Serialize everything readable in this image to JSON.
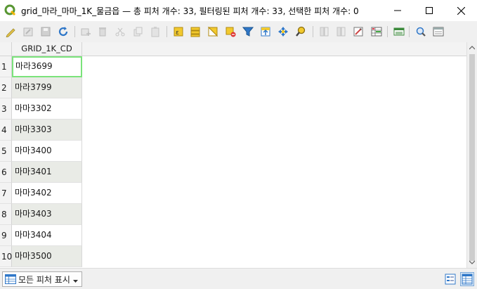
{
  "window": {
    "title": "grid_마라_마마_1K_물금읍 — 총 피처 개수: 33, 필터링된 피처 개수: 33, 선택한 피처 개수: 0"
  },
  "toolbar": {
    "icons": [
      "pencil-icon",
      "multi-edit-icon",
      "save-icon",
      "reload-icon",
      "add-feature-icon",
      "delete-icon",
      "cut-icon",
      "copy-icon",
      "paste-icon",
      "select-by-expression-icon",
      "select-all-icon",
      "invert-selection-icon",
      "deselect-icon",
      "filter-icon",
      "move-to-top-icon",
      "pan-to-selection-icon",
      "zoom-to-selection-icon",
      "new-field-icon",
      "delete-field-icon",
      "field-calculator-icon",
      "conditional-format-icon",
      "dock-icon",
      "actions-icon",
      "form-view-icon"
    ]
  },
  "table": {
    "columns": [
      "GRID_1K_CD"
    ],
    "row_numbers": [
      "1",
      "2",
      "3",
      "4",
      "5",
      "6",
      "7",
      "8",
      "9",
      "10"
    ],
    "cells": [
      "마라3699",
      "마라3799",
      "마마3302",
      "마마3303",
      "마마3400",
      "마마3401",
      "마마3402",
      "마마3403",
      "마마3404",
      "마마3500"
    ],
    "active_row": 1
  },
  "bottom": {
    "filter_label": "모든 피처 표시"
  },
  "colors": {
    "alt_row": "#e9ebe6",
    "active_cell_border": "#7be37b",
    "icon_yellow": "#f2c92e",
    "icon_blue": "#2f77c8"
  }
}
